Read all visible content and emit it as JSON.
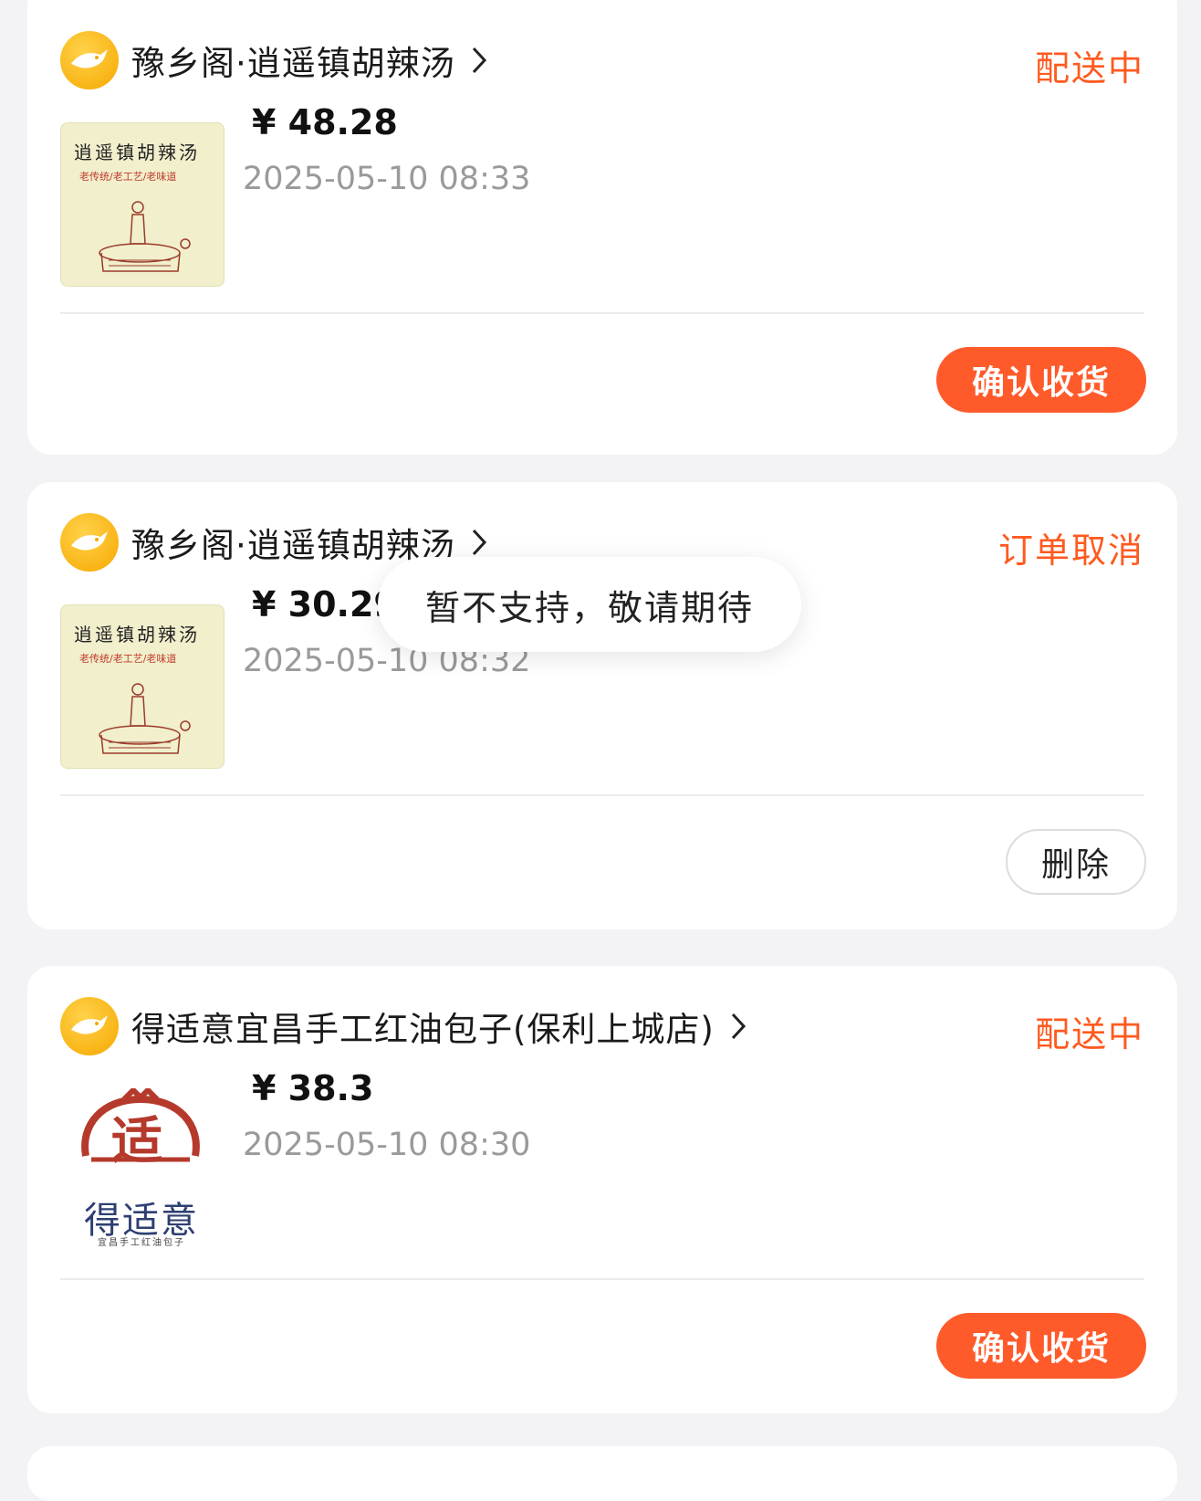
{
  "orders": [
    {
      "shop_name": "豫乡阁·逍遥镇胡辣汤",
      "status": "配送中",
      "price": "¥ 48.28",
      "time": "2025-05-10 08:33",
      "action": "确认收货",
      "thumb_title": "逍遥镇胡辣汤",
      "thumb_sub": "老传统/老工艺/老味道"
    },
    {
      "shop_name": "豫乡阁·逍遥镇胡辣汤",
      "status": "订单取消",
      "price": "¥ 30.29",
      "time": "2025-05-10 08:32",
      "action": "删除",
      "thumb_title": "逍遥镇胡辣汤",
      "thumb_sub": "老传统/老工艺/老味道"
    },
    {
      "shop_name": "得适意宜昌手工红油包子(保利上城店)",
      "status": "配送中",
      "price": "¥ 38.3",
      "time": "2025-05-10 08:30",
      "action": "确认收货",
      "thumb_char": "适",
      "thumb_title": "得适意",
      "thumb_sub": "宜昌手工红油包子"
    }
  ],
  "toast": "暂不支持，敬请期待",
  "colors": {
    "accent": "#ff5a2a",
    "status": "#ff5a1f",
    "logo": "#f6a800"
  },
  "icons": {
    "shop_logo": "rabbit-logo-icon",
    "chevron": "chevron-right-icon"
  }
}
